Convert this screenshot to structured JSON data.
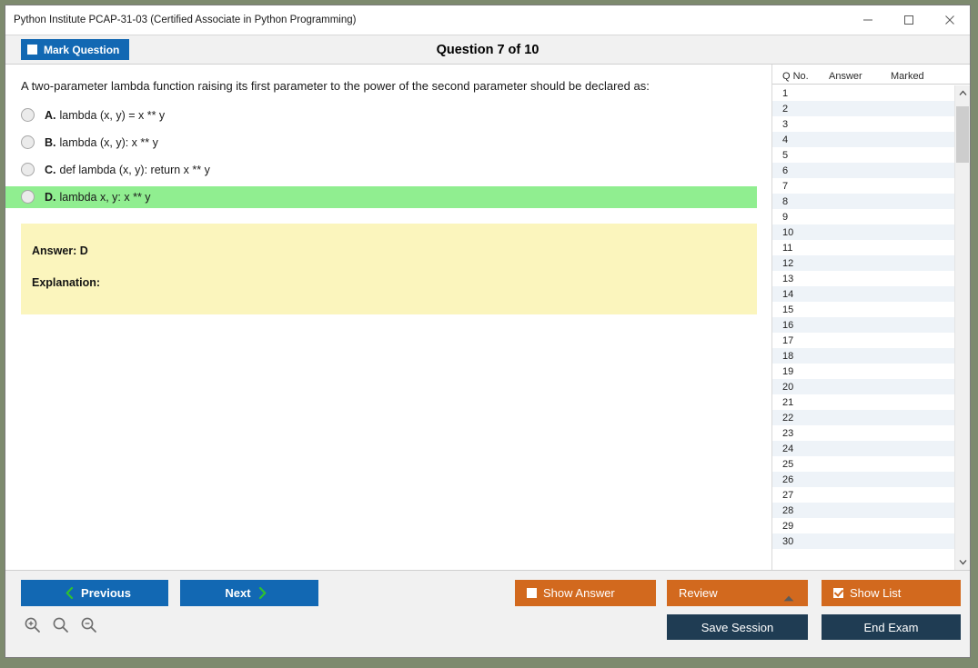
{
  "window": {
    "title": "Python Institute PCAP-31-03 (Certified Associate in Python Programming)",
    "minimize_label": "—",
    "maximize_label": "□",
    "close_label": "✕"
  },
  "header": {
    "mark_question_label": "Mark Question",
    "question_counter": "Question 7 of 10"
  },
  "question": {
    "text": "A two-parameter lambda function raising its first parameter to the power of the second parameter should be declared as:",
    "options": [
      {
        "letter": "A.",
        "text": "lambda (x, y) = x ** y",
        "correct": false
      },
      {
        "letter": "B.",
        "text": "lambda (x, y): x ** y",
        "correct": false
      },
      {
        "letter": "C.",
        "text": "def lambda (x, y): return x ** y",
        "correct": false
      },
      {
        "letter": "D.",
        "text": "lambda x, y: x ** y",
        "correct": true
      }
    ],
    "answer_line": "Answer: D",
    "explanation_line": "Explanation:"
  },
  "question_list": {
    "columns": [
      "Q No.",
      "Answer",
      "Marked"
    ],
    "rows": [
      {
        "no": "1",
        "answer": "",
        "marked": ""
      },
      {
        "no": "2",
        "answer": "",
        "marked": ""
      },
      {
        "no": "3",
        "answer": "",
        "marked": ""
      },
      {
        "no": "4",
        "answer": "",
        "marked": ""
      },
      {
        "no": "5",
        "answer": "",
        "marked": ""
      },
      {
        "no": "6",
        "answer": "",
        "marked": ""
      },
      {
        "no": "7",
        "answer": "",
        "marked": ""
      },
      {
        "no": "8",
        "answer": "",
        "marked": ""
      },
      {
        "no": "9",
        "answer": "",
        "marked": ""
      },
      {
        "no": "10",
        "answer": "",
        "marked": ""
      },
      {
        "no": "11",
        "answer": "",
        "marked": ""
      },
      {
        "no": "12",
        "answer": "",
        "marked": ""
      },
      {
        "no": "13",
        "answer": "",
        "marked": ""
      },
      {
        "no": "14",
        "answer": "",
        "marked": ""
      },
      {
        "no": "15",
        "answer": "",
        "marked": ""
      },
      {
        "no": "16",
        "answer": "",
        "marked": ""
      },
      {
        "no": "17",
        "answer": "",
        "marked": ""
      },
      {
        "no": "18",
        "answer": "",
        "marked": ""
      },
      {
        "no": "19",
        "answer": "",
        "marked": ""
      },
      {
        "no": "20",
        "answer": "",
        "marked": ""
      },
      {
        "no": "21",
        "answer": "",
        "marked": ""
      },
      {
        "no": "22",
        "answer": "",
        "marked": ""
      },
      {
        "no": "23",
        "answer": "",
        "marked": ""
      },
      {
        "no": "24",
        "answer": "",
        "marked": ""
      },
      {
        "no": "25",
        "answer": "",
        "marked": ""
      },
      {
        "no": "26",
        "answer": "",
        "marked": ""
      },
      {
        "no": "27",
        "answer": "",
        "marked": ""
      },
      {
        "no": "28",
        "answer": "",
        "marked": ""
      },
      {
        "no": "29",
        "answer": "",
        "marked": ""
      },
      {
        "no": "30",
        "answer": "",
        "marked": ""
      }
    ]
  },
  "footer": {
    "previous_label": "Previous",
    "next_label": "Next",
    "show_answer_label": "Show Answer",
    "review_label": "Review",
    "show_list_label": "Show List",
    "save_session_label": "Save Session",
    "end_exam_label": "End Exam",
    "zoom_in_icon": "zoom-in-icon",
    "zoom_reset_icon": "zoom-reset-icon",
    "zoom_out_icon": "zoom-out-icon"
  },
  "colors": {
    "primary_blue": "#1268b3",
    "accent_orange": "#d2691e",
    "dark_navy": "#1f3c53",
    "correct_green": "#90ee90",
    "answer_yellow": "#fbf5bd",
    "chevron_green": "#2fc02f"
  }
}
